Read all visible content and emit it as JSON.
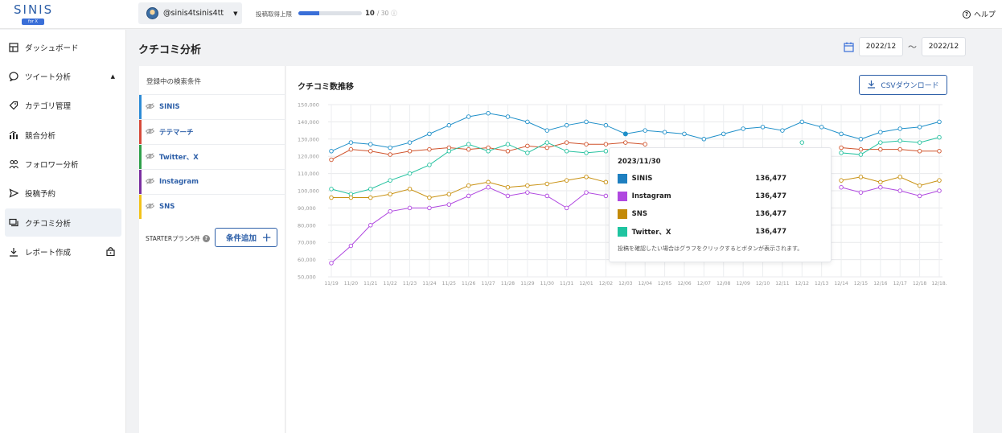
{
  "app": {
    "logo_text": "SINIS",
    "logo_badge": "for X",
    "help_label": "ヘルプ",
    "help_symbol": "?"
  },
  "account": {
    "handle": "@sinis4tsinis4tt"
  },
  "quota": {
    "label": "投稿取得上限",
    "used": "10",
    "total": "/ 30",
    "fraction": 0.333
  },
  "sidebar": {
    "items": [
      {
        "label": "ダッシュボード",
        "icon": "dashboard-icon"
      },
      {
        "label": "ツイート分析",
        "icon": "chat-icon",
        "expanded": true
      },
      {
        "label": "カテゴリ管理",
        "icon": "tag-icon"
      },
      {
        "label": "競合分析",
        "icon": "bars-icon"
      },
      {
        "label": "フォロワー分析",
        "icon": "users-icon"
      },
      {
        "label": "投稿予約",
        "icon": "send-icon"
      },
      {
        "label": "クチコミ分析",
        "icon": "comments-icon",
        "active": true
      },
      {
        "label": "レポート作成",
        "icon": "download-icon",
        "locked": true
      }
    ]
  },
  "page": {
    "title": "クチコミ分析",
    "date_from": "2022/12",
    "date_to": "2022/12",
    "date_sep": "〜"
  },
  "conditions": {
    "heading": "登録中の検索条件",
    "items": [
      {
        "label": "SINIS",
        "color": "#2d8bd6"
      },
      {
        "label": "テテマーチ",
        "color": "#d64a3a"
      },
      {
        "label": "Twitter、X",
        "color": "#2fa04a"
      },
      {
        "label": "Instagram",
        "color": "#7a2fa0"
      },
      {
        "label": "SNS",
        "color": "#f2c21a"
      }
    ],
    "plan_note": "STARTERプラン5件",
    "add_button": "条件追加",
    "plus_symbol": "+"
  },
  "chart": {
    "title": "クチコミ数推移",
    "csv_button": "CSVダウンロード"
  },
  "tooltip": {
    "date": "2023/11/30",
    "rows": [
      {
        "name": "SINIS",
        "value": "136,477",
        "color": "#1e7fc0"
      },
      {
        "name": "Instagram",
        "value": "136,477",
        "color": "#b048e0"
      },
      {
        "name": "SNS",
        "value": "136,477",
        "color": "#c38a08"
      },
      {
        "name": "Twitter、X",
        "value": "136,477",
        "color": "#1fc4a0"
      }
    ],
    "note": "投稿を確認したい場合はグラフをクリックするとボタンが表示されます。"
  },
  "chart_data": {
    "type": "line",
    "categories": [
      "11/19",
      "11/20",
      "11/21",
      "11/22",
      "11/23",
      "11/24",
      "11/25",
      "11/26",
      "11/27",
      "11/28",
      "11/29",
      "11/30",
      "11/31",
      "12/01",
      "12/02",
      "12/03",
      "12/04",
      "12/05",
      "12/06",
      "12/07",
      "12/08",
      "12/09",
      "12/10",
      "12/11",
      "12/12",
      "12/13",
      "12/14",
      "12/15",
      "12/16",
      "12/17",
      "12/18",
      "12/18."
    ],
    "ylim": [
      50000,
      150000
    ],
    "yticks": [
      "150,000",
      "140,000",
      "130,000",
      "120,000",
      "110,000",
      "100,000",
      "90,000",
      "80,000",
      "70,000",
      "60,000",
      "50,000"
    ],
    "series": [
      {
        "color": "#1e8fc9",
        "values": [
          123000,
          128000,
          127000,
          125000,
          128000,
          133000,
          138000,
          143000,
          145000,
          143000,
          140000,
          135000,
          138000,
          140000,
          138000,
          133000,
          135000,
          134000,
          133000,
          130000,
          133000,
          136000,
          137000,
          135000,
          140000,
          137000,
          133000,
          130000,
          134000,
          136000,
          137000,
          140000
        ]
      },
      {
        "color": "#d0532c",
        "values": [
          118000,
          124000,
          123000,
          121000,
          123000,
          124000,
          125000,
          124000,
          125000,
          123000,
          126000,
          125000,
          128000,
          127000,
          127000,
          128000,
          127000,
          null,
          null,
          null,
          null,
          null,
          null,
          null,
          null,
          null,
          125000,
          124000,
          124000,
          124000,
          123000,
          123000
        ]
      },
      {
        "color": "#26c2a0",
        "values": [
          101000,
          98000,
          101000,
          106000,
          110000,
          115000,
          123000,
          127000,
          123000,
          127000,
          122000,
          128000,
          123000,
          122000,
          123000,
          null,
          null,
          null,
          null,
          null,
          null,
          null,
          null,
          null,
          128000,
          null,
          122000,
          121000,
          128000,
          129000,
          128000,
          131000
        ]
      },
      {
        "color": "#c8900f",
        "values": [
          96000,
          96000,
          96000,
          98000,
          101000,
          96000,
          98000,
          103000,
          105000,
          102000,
          103000,
          104000,
          106000,
          108000,
          105000,
          null,
          null,
          null,
          null,
          null,
          null,
          null,
          null,
          null,
          null,
          null,
          106000,
          108000,
          105000,
          108000,
          103000,
          106000
        ]
      },
      {
        "color": "#b048e0",
        "values": [
          58000,
          68000,
          80000,
          88000,
          90000,
          90000,
          92000,
          97000,
          102000,
          97000,
          99000,
          97000,
          90000,
          99000,
          97000,
          null,
          null,
          null,
          null,
          null,
          null,
          null,
          null,
          null,
          null,
          null,
          102000,
          99000,
          102000,
          100000,
          97000,
          100000
        ]
      }
    ]
  }
}
